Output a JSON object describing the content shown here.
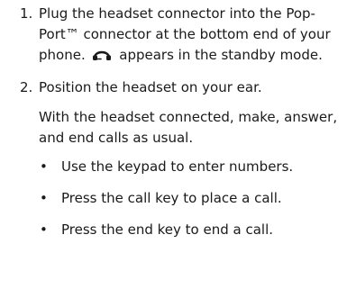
{
  "steps": [
    {
      "number": "1.",
      "text_before_icon": "Plug the headset connector into the Pop-Port™ connector at the bottom end of your phone. ",
      "icon": "headset-icon",
      "text_after_icon": " appears in the standby mode."
    },
    {
      "number": "2.",
      "text": "Position the headset on your ear.",
      "paragraph": "With the headset connected, make, answer, and end calls as usual.",
      "bullets": [
        "Use the keypad to enter numbers.",
        "Press the call key to place a call.",
        "Press the end key to end a call."
      ]
    }
  ],
  "bullet_glyph": "•"
}
